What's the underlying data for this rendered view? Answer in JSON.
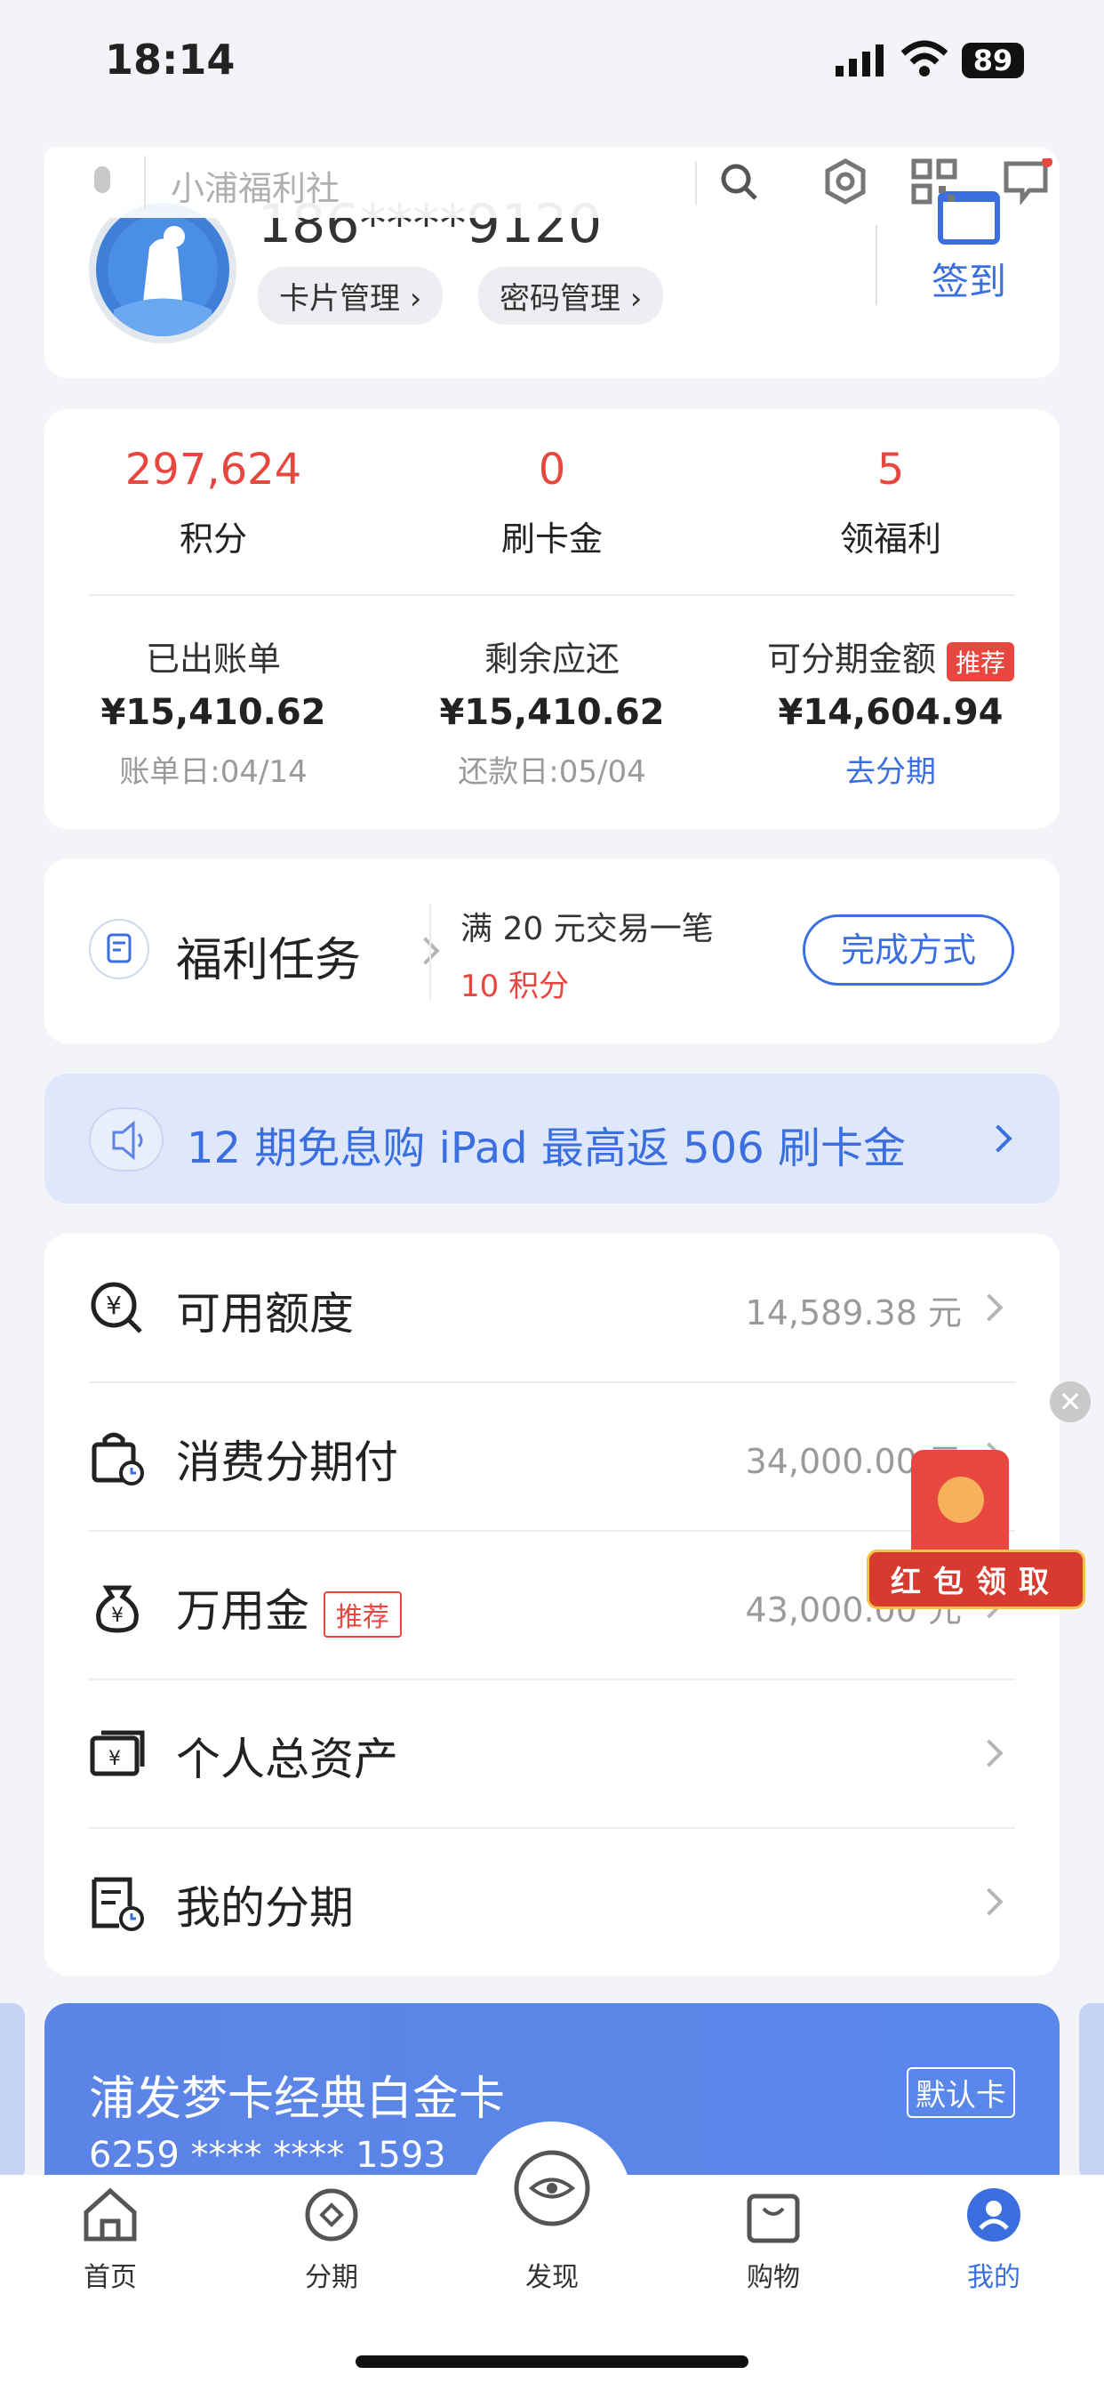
{
  "status_bar": {
    "time": "18:14",
    "battery": "89"
  },
  "search": {
    "placeholder": "小浦福利社"
  },
  "profile": {
    "phone": "186****9120",
    "card_mgmt": "卡片管理",
    "pwd_mgmt": "密码管理",
    "checkin": "签到"
  },
  "stats": [
    {
      "value": "297,624",
      "label": "积分"
    },
    {
      "value": "0",
      "label": "刷卡金"
    },
    {
      "value": "5",
      "label": "领福利"
    }
  ],
  "bills": [
    {
      "title": "已出账单",
      "amount": "¥15,410.62",
      "sub": "账单日:04/14"
    },
    {
      "title": "剩余应还",
      "amount": "¥15,410.62",
      "sub": "还款日:05/04"
    },
    {
      "title": "可分期金额",
      "tag": "推荐",
      "amount": "¥14,604.94",
      "sub": "去分期"
    }
  ],
  "task": {
    "title": "福利任务",
    "desc": "满 20 元交易一笔",
    "reward": "10 积分",
    "button": "完成方式"
  },
  "banner": {
    "text": "12 期免息购 iPad 最高返 506 刷卡金"
  },
  "rows": [
    {
      "label": "可用额度",
      "value": "14,589.38 元",
      "icon": "yen-search-icon"
    },
    {
      "label": "消费分期付",
      "value": "34,000.00 元",
      "icon": "shopping-bag-clock-icon"
    },
    {
      "label": "万用金",
      "tag": "推荐",
      "value": "43,000.00 元",
      "icon": "money-bag-icon"
    },
    {
      "label": "个人总资产",
      "value": "",
      "icon": "asset-card-icon"
    },
    {
      "label": "我的分期",
      "value": "",
      "icon": "installment-doc-icon"
    }
  ],
  "promo": {
    "text": "红包领取"
  },
  "card": {
    "name": "浦发梦卡经典白金卡",
    "number": "6259 **** **** 1593",
    "default_label": "默认卡"
  },
  "nav": [
    {
      "label": "首页",
      "icon": "home-icon"
    },
    {
      "label": "分期",
      "icon": "installment-icon"
    },
    {
      "label": "发现",
      "icon": "discover-icon"
    },
    {
      "label": "购物",
      "icon": "shopping-bag-icon"
    },
    {
      "label": "我的",
      "icon": "profile-icon"
    }
  ],
  "colors": {
    "accent": "#3b6fe0",
    "red": "#e8473f",
    "card_blue": "#5b84e6"
  }
}
